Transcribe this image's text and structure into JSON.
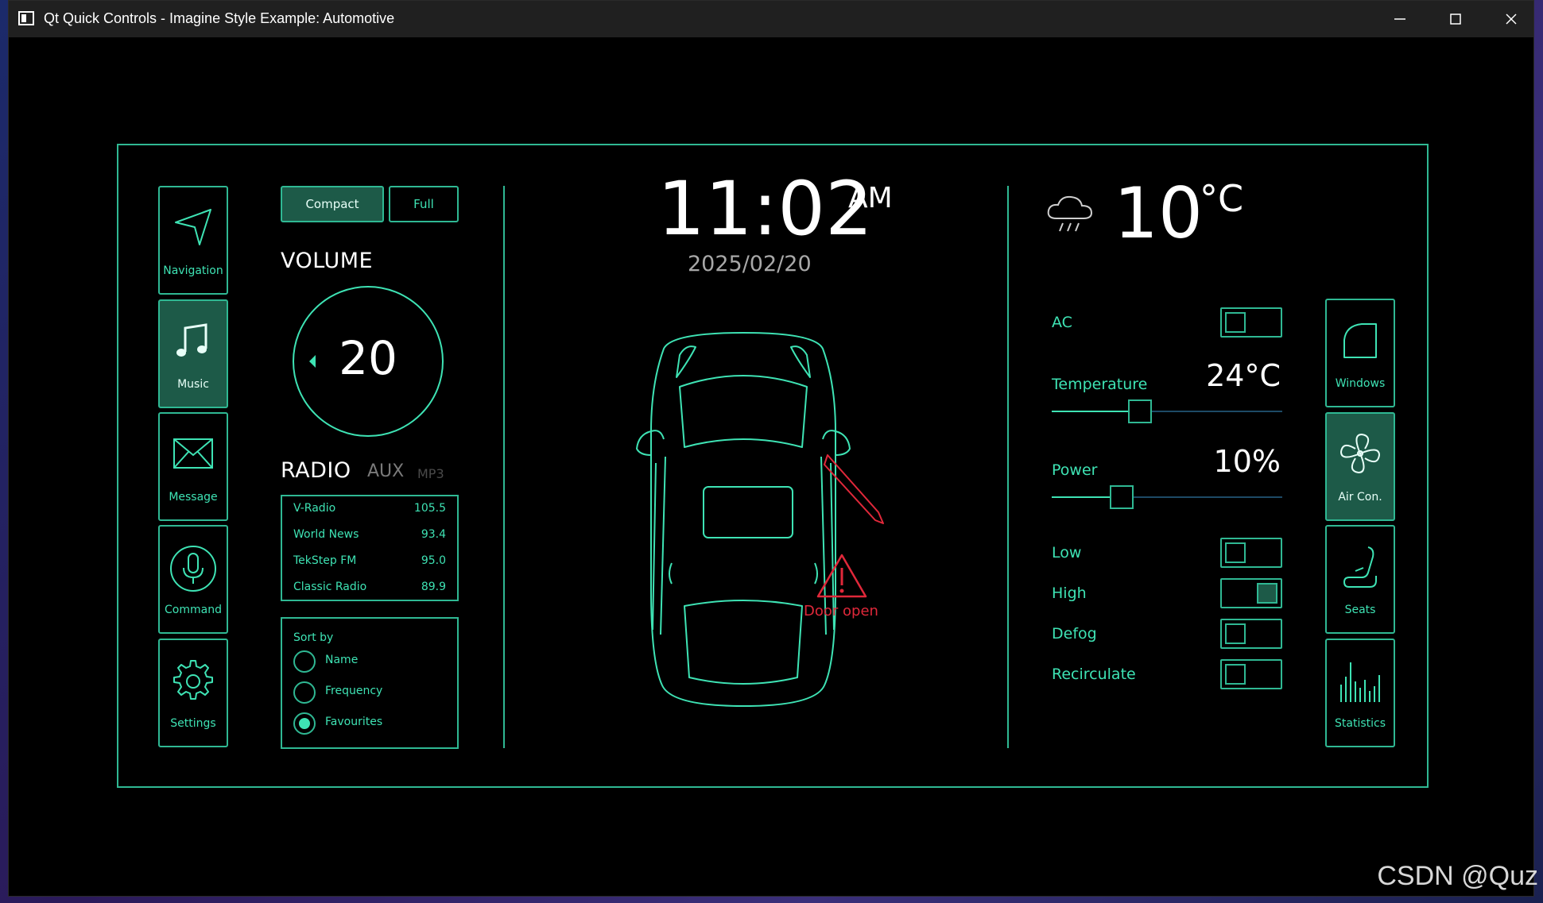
{
  "window": {
    "title": "Qt Quick Controls - Imagine Style Example: Automotive"
  },
  "sidebar_left": {
    "items": [
      {
        "label": "Navigation",
        "icon": "navigation-arrow-icon",
        "active": false
      },
      {
        "label": "Music",
        "icon": "music-note-icon",
        "active": true
      },
      {
        "label": "Message",
        "icon": "envelope-icon",
        "active": false
      },
      {
        "label": "Command",
        "icon": "microphone-icon",
        "active": false
      },
      {
        "label": "Settings",
        "icon": "gear-icon",
        "active": false
      }
    ]
  },
  "view_mode": {
    "compact": "Compact",
    "full": "Full",
    "selected": "Compact"
  },
  "volume": {
    "heading": "VOLUME",
    "value": "20"
  },
  "radio": {
    "tabs": [
      "RADIO",
      "AUX",
      "MP3"
    ],
    "selected_tab": "RADIO",
    "stations": [
      {
        "name": "V-Radio",
        "freq": "105.5"
      },
      {
        "name": "World News",
        "freq": "93.4"
      },
      {
        "name": "TekStep FM",
        "freq": "95.0"
      },
      {
        "name": "Classic Radio",
        "freq": "89.9"
      }
    ],
    "sort": {
      "label": "Sort by",
      "options": [
        "Name",
        "Frequency",
        "Favourites"
      ],
      "selected": "Favourites"
    }
  },
  "clock": {
    "time": "11:02",
    "ampm": "AM",
    "date": "2025/02/20"
  },
  "alert": {
    "text": "Door open",
    "icon": "warning-triangle-icon",
    "color": "#e0283a"
  },
  "weather": {
    "icon": "rain-cloud-icon",
    "temp": "10",
    "unit": "°C"
  },
  "climate": {
    "ac": {
      "label": "AC",
      "on": false
    },
    "temperature": {
      "label": "Temperature",
      "value": "24°C",
      "level": 0.37
    },
    "power": {
      "label": "Power",
      "value": "10%",
      "level": 0.28
    },
    "toggles": [
      {
        "label": "Low",
        "on": false
      },
      {
        "label": "High",
        "on": true
      },
      {
        "label": "Defog",
        "on": false
      },
      {
        "label": "Recirculate",
        "on": false
      }
    ]
  },
  "sidebar_right": {
    "items": [
      {
        "label": "Windows",
        "icon": "window-icon",
        "active": false
      },
      {
        "label": "Air Con.",
        "icon": "fan-icon",
        "active": true
      },
      {
        "label": "Seats",
        "icon": "seat-icon",
        "active": false
      },
      {
        "label": "Statistics",
        "icon": "bar-statistics-icon",
        "active": false
      }
    ]
  },
  "colors": {
    "accent": "#3ee3b4",
    "accent_fill": "#1d5a48",
    "border": "#2fb893",
    "alert": "#e0283a"
  },
  "watermark": "CSDN @Quz"
}
